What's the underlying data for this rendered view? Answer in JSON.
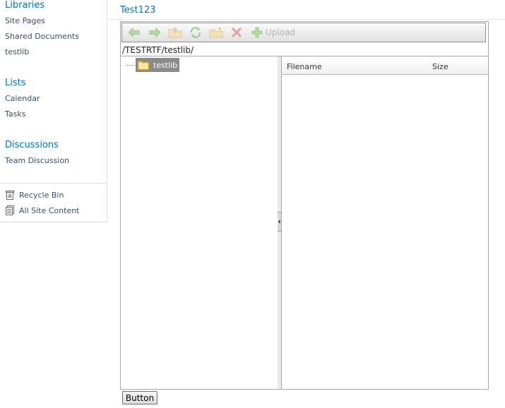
{
  "leftnav": {
    "sections": [
      {
        "heading": "Libraries",
        "items": [
          "Site Pages",
          "Shared Documents",
          "testlib"
        ]
      },
      {
        "heading": "Lists",
        "items": [
          "Calendar",
          "Tasks"
        ]
      },
      {
        "heading": "Discussions",
        "items": [
          "Team Discussion"
        ]
      }
    ],
    "bottom_links": [
      {
        "label": "Recycle Bin",
        "icon": "recycle-bin-icon"
      },
      {
        "label": "All Site Content",
        "icon": "site-content-icon"
      }
    ]
  },
  "main": {
    "site_title": "Test123",
    "toolbar": {
      "buttons": [
        "back-arrow-icon",
        "forward-arrow-icon",
        "up-folder-icon",
        "refresh-icon",
        "new-folder-icon",
        "delete-icon",
        "upload-icon"
      ],
      "upload_label": "Upload"
    },
    "path": "/TESTRTF/testlib/",
    "tree": {
      "selected_node": "testlib"
    },
    "file_list": {
      "columns": [
        "Filename",
        "Size"
      ],
      "rows": []
    },
    "button_label": "Button"
  },
  "colors": {
    "link": "#0072bc",
    "nav_text": "#3b4f65",
    "selected_node_bg": "#8b8b8b"
  }
}
